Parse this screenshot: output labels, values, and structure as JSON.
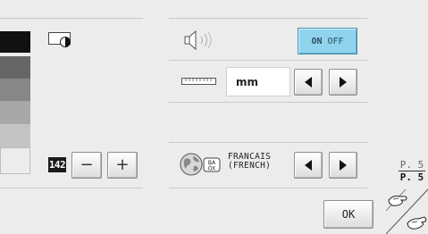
{
  "swatches": [
    {
      "color": "#111111"
    },
    {
      "color": "#666666"
    },
    {
      "color": "#878787"
    },
    {
      "color": "#a8a8a8"
    },
    {
      "color": "#c4c4c4"
    },
    {
      "color": "#ececec"
    }
  ],
  "screen_count": "142",
  "minus_label": "−",
  "plus_label": "+",
  "toggle": {
    "on_label": "ON",
    "off_label": "OFF",
    "state": "on"
  },
  "unit": {
    "value": "mm"
  },
  "language": {
    "line1": "FRANCAIS",
    "line2": "(FRENCH)"
  },
  "page": {
    "current": "P. 5",
    "total": "P. 5"
  },
  "ok_label": "OK",
  "colors": {
    "accent_toggle": "#8fd3ec",
    "background": "#ececec"
  }
}
